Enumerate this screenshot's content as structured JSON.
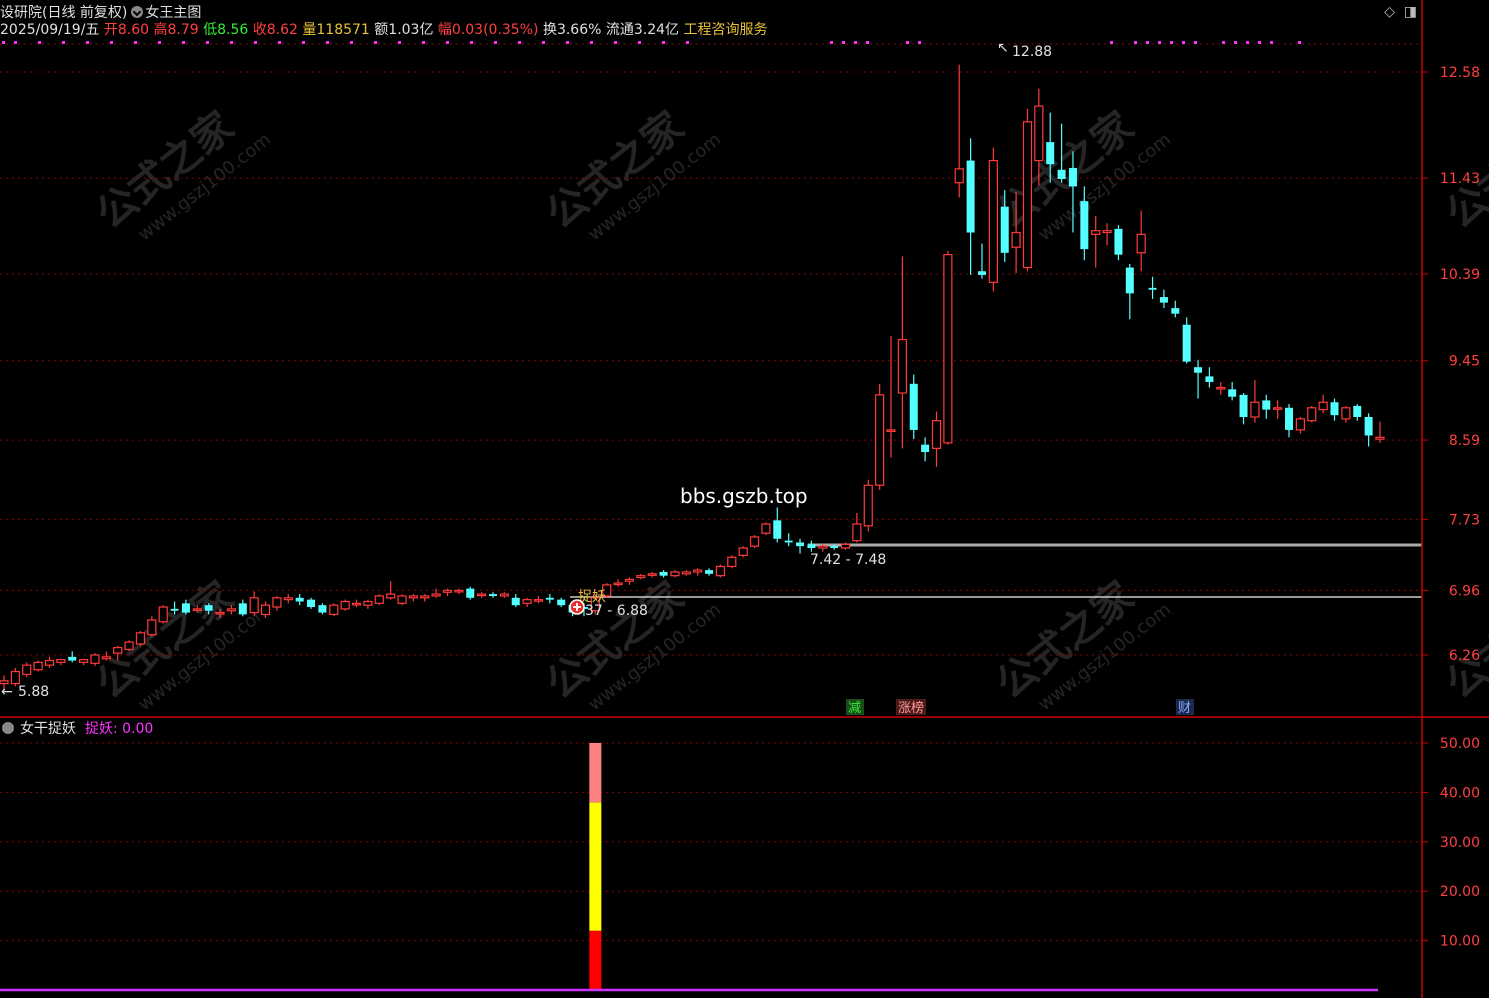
{
  "header": {
    "name": "设研院",
    "period": "(日线 前复权)",
    "indicator": "女王主图",
    "date": "2025/09/19/五",
    "open_label": "开",
    "open": "8.60",
    "high_label": "高",
    "high": "8.79",
    "low_label": "低",
    "low": "8.56",
    "close_label": "收",
    "close": "8.62",
    "vol_label": "量",
    "vol": "118571",
    "amount_label": "额",
    "amount": "1.03亿",
    "chg_label": "幅",
    "chg": "0.03(0.35%)",
    "turnover_label": "换",
    "turnover": "3.66%",
    "float_label": "流通",
    "float": "3.24亿",
    "industry": "工程咨询服务"
  },
  "colors": {
    "up": "#ff3a3a",
    "down": "#54ffff",
    "grid": "#8a0000",
    "axis": "#cc0000",
    "magenta": "#ff33ff"
  },
  "annotations": {
    "max_label": "12.88",
    "min_label": "5.88",
    "range_top_label": "7.42 - 7.48",
    "range_bottom_label": "37 - 6.88",
    "signal_label": "捉妖",
    "watermark_site": "bbs.gszb.top",
    "event_1": "减",
    "event_2": "涨榜",
    "event_3": "财",
    "watermark_cn": "公式之家",
    "watermark_url": "www.gszj100.com"
  },
  "sub": {
    "title": "女干捉妖",
    "value_label": "捉妖: 0.00"
  },
  "chart_data": [
    {
      "type": "candlestick",
      "title": "女王主图",
      "y_ticks": [
        "12.58",
        "11.43",
        "10.39",
        "9.45",
        "8.59",
        "7.73",
        "6.96",
        "6.26"
      ],
      "y_tick_values": [
        12.58,
        11.43,
        10.39,
        9.45,
        8.59,
        7.73,
        6.96,
        6.26
      ],
      "ylim": [
        5.6,
        13.2
      ],
      "grid": true,
      "support_levels": [
        7.42,
        6.88
      ],
      "candles": [
        [
          5.95,
          6.04,
          5.88,
          5.98
        ],
        [
          5.95,
          6.12,
          5.92,
          6.08
        ],
        [
          6.05,
          6.18,
          6.02,
          6.15
        ],
        [
          6.1,
          6.2,
          6.08,
          6.18
        ],
        [
          6.15,
          6.24,
          6.12,
          6.2
        ],
        [
          6.18,
          6.22,
          6.15,
          6.21
        ],
        [
          6.24,
          6.3,
          6.18,
          6.2
        ],
        [
          6.18,
          6.22,
          6.15,
          6.21
        ],
        [
          6.17,
          6.28,
          6.14,
          6.26
        ],
        [
          6.22,
          6.3,
          6.2,
          6.24
        ],
        [
          6.28,
          6.36,
          6.2,
          6.34
        ],
        [
          6.32,
          6.42,
          6.3,
          6.4
        ],
        [
          6.38,
          6.52,
          6.36,
          6.5
        ],
        [
          6.48,
          6.68,
          6.46,
          6.64
        ],
        [
          6.62,
          6.8,
          6.6,
          6.78
        ],
        [
          6.76,
          6.84,
          6.7,
          6.74
        ],
        [
          6.82,
          6.86,
          6.7,
          6.72
        ],
        [
          6.76,
          6.8,
          6.72,
          6.76
        ],
        [
          6.8,
          6.82,
          6.7,
          6.74
        ],
        [
          6.72,
          6.76,
          6.66,
          6.72
        ],
        [
          6.74,
          6.8,
          6.7,
          6.76
        ],
        [
          6.82,
          6.86,
          6.68,
          6.7
        ],
        [
          6.72,
          6.95,
          6.68,
          6.88
        ],
        [
          6.7,
          6.84,
          6.66,
          6.8
        ],
        [
          6.78,
          6.9,
          6.74,
          6.88
        ],
        [
          6.86,
          6.92,
          6.82,
          6.88
        ],
        [
          6.88,
          6.92,
          6.8,
          6.84
        ],
        [
          6.86,
          6.88,
          6.76,
          6.78
        ],
        [
          6.8,
          6.82,
          6.7,
          6.72
        ],
        [
          6.7,
          6.82,
          6.68,
          6.8
        ],
        [
          6.76,
          6.86,
          6.74,
          6.84
        ],
        [
          6.82,
          6.86,
          6.78,
          6.82
        ],
        [
          6.8,
          6.86,
          6.76,
          6.84
        ],
        [
          6.82,
          6.92,
          6.8,
          6.9
        ],
        [
          6.88,
          7.06,
          6.86,
          6.92
        ],
        [
          6.82,
          6.92,
          6.8,
          6.9
        ],
        [
          6.88,
          6.92,
          6.84,
          6.9
        ],
        [
          6.88,
          6.92,
          6.84,
          6.9
        ],
        [
          6.9,
          6.98,
          6.88,
          6.92
        ],
        [
          6.94,
          6.98,
          6.9,
          6.96
        ],
        [
          6.96,
          6.98,
          6.92,
          6.96
        ],
        [
          6.98,
          7.0,
          6.86,
          6.88
        ],
        [
          6.92,
          6.94,
          6.88,
          6.92
        ],
        [
          6.92,
          6.94,
          6.88,
          6.9
        ],
        [
          6.9,
          6.94,
          6.88,
          6.92
        ],
        [
          6.88,
          6.92,
          6.78,
          6.8
        ],
        [
          6.82,
          6.88,
          6.78,
          6.86
        ],
        [
          6.86,
          6.9,
          6.82,
          6.86
        ],
        [
          6.88,
          6.92,
          6.82,
          6.86
        ],
        [
          6.86,
          6.88,
          6.78,
          6.8
        ],
        [
          6.8,
          6.84,
          6.68,
          6.72
        ],
        [
          6.78,
          6.82,
          6.68,
          6.76
        ],
        [
          6.74,
          6.92,
          6.7,
          6.88
        ],
        [
          6.9,
          7.04,
          6.88,
          7.02
        ],
        [
          7.04,
          7.08,
          7.0,
          7.04
        ],
        [
          7.06,
          7.1,
          7.02,
          7.08
        ],
        [
          7.1,
          7.14,
          7.08,
          7.12
        ],
        [
          7.14,
          7.16,
          7.1,
          7.14
        ],
        [
          7.16,
          7.18,
          7.1,
          7.12
        ],
        [
          7.12,
          7.18,
          7.1,
          7.16
        ],
        [
          7.14,
          7.18,
          7.12,
          7.16
        ],
        [
          7.16,
          7.2,
          7.12,
          7.18
        ],
        [
          7.18,
          7.2,
          7.12,
          7.14
        ],
        [
          7.12,
          7.24,
          7.1,
          7.22
        ],
        [
          7.22,
          7.34,
          7.2,
          7.32
        ],
        [
          7.34,
          7.44,
          7.32,
          7.42
        ],
        [
          7.44,
          7.56,
          7.42,
          7.54
        ],
        [
          7.58,
          7.7,
          7.56,
          7.68
        ],
        [
          7.72,
          7.86,
          7.48,
          7.52
        ],
        [
          7.5,
          7.58,
          7.44,
          7.48
        ],
        [
          7.48,
          7.52,
          7.36,
          7.44
        ],
        [
          7.46,
          7.5,
          7.38,
          7.42
        ],
        [
          7.42,
          7.46,
          7.38,
          7.44
        ],
        [
          7.44,
          7.46,
          7.4,
          7.42
        ],
        [
          7.42,
          7.48,
          7.4,
          7.46
        ],
        [
          7.5,
          7.8,
          7.48,
          7.68
        ],
        [
          7.66,
          8.16,
          7.6,
          8.1
        ],
        [
          8.1,
          9.2,
          8.05,
          9.08
        ],
        [
          8.7,
          9.72,
          8.4,
          8.7
        ],
        [
          9.1,
          10.58,
          8.5,
          9.68
        ],
        [
          9.2,
          9.3,
          8.6,
          8.7
        ],
        [
          8.54,
          8.62,
          8.36,
          8.46
        ],
        [
          8.5,
          8.9,
          8.3,
          8.8
        ],
        [
          8.56,
          10.64,
          8.54,
          10.6
        ],
        [
          11.38,
          12.66,
          11.22,
          11.53
        ],
        [
          11.62,
          11.86,
          10.38,
          10.84
        ],
        [
          10.42,
          10.72,
          10.34,
          10.38
        ],
        [
          10.3,
          11.76,
          10.2,
          11.62
        ],
        [
          11.12,
          11.3,
          10.52,
          10.62
        ],
        [
          10.68,
          11.28,
          10.4,
          10.84
        ],
        [
          10.46,
          12.18,
          10.42,
          12.04
        ],
        [
          11.62,
          12.4,
          11.35,
          12.21
        ],
        [
          11.82,
          12.14,
          11.38,
          11.58
        ],
        [
          11.52,
          12.02,
          11.38,
          11.42
        ],
        [
          11.54,
          11.72,
          10.84,
          11.34
        ],
        [
          11.18,
          11.34,
          10.54,
          10.66
        ],
        [
          10.82,
          11.02,
          10.46,
          10.86
        ],
        [
          10.84,
          10.94,
          10.7,
          10.86
        ],
        [
          10.88,
          10.92,
          10.54,
          10.6
        ],
        [
          10.46,
          10.5,
          9.9,
          10.18
        ],
        [
          10.62,
          11.08,
          10.42,
          10.82
        ],
        [
          10.24,
          10.36,
          10.12,
          10.22
        ],
        [
          10.14,
          10.22,
          10.02,
          10.08
        ],
        [
          10.02,
          10.1,
          9.92,
          9.96
        ],
        [
          9.84,
          9.92,
          9.42,
          9.44
        ],
        [
          9.38,
          9.46,
          9.04,
          9.32
        ],
        [
          9.28,
          9.38,
          9.16,
          9.22
        ],
        [
          9.16,
          9.22,
          9.08,
          9.16
        ],
        [
          9.14,
          9.22,
          9.02,
          9.06
        ],
        [
          9.08,
          9.1,
          8.76,
          8.84
        ],
        [
          8.84,
          9.24,
          8.78,
          9.0
        ],
        [
          9.02,
          9.08,
          8.82,
          8.92
        ],
        [
          8.94,
          9.02,
          8.82,
          8.94
        ],
        [
          8.94,
          8.98,
          8.62,
          8.7
        ],
        [
          8.7,
          8.84,
          8.66,
          8.82
        ],
        [
          8.8,
          8.96,
          8.78,
          8.94
        ],
        [
          8.92,
          9.08,
          8.88,
          9.0
        ],
        [
          9.0,
          9.04,
          8.8,
          8.86
        ],
        [
          8.82,
          8.96,
          8.78,
          8.94
        ],
        [
          8.96,
          8.98,
          8.8,
          8.84
        ],
        [
          8.84,
          8.88,
          8.52,
          8.64
        ],
        [
          8.6,
          8.79,
          8.56,
          8.62
        ]
      ],
      "sub_chart": {
        "type": "bar",
        "title": "女干捉妖",
        "y_ticks": [
          "50.00",
          "40.00",
          "30.00",
          "20.00",
          "10.00"
        ],
        "ylim": [
          0,
          50
        ],
        "signal_index": 52,
        "signal_value": 50,
        "segments": [
          {
            "from": 0,
            "to": 12,
            "color": "#ff0000"
          },
          {
            "from": 12,
            "to": 38,
            "color": "#ffff00"
          },
          {
            "from": 38,
            "to": 50,
            "color": "#ff8080"
          }
        ],
        "baseline_color": "#cc33ff"
      }
    }
  ]
}
